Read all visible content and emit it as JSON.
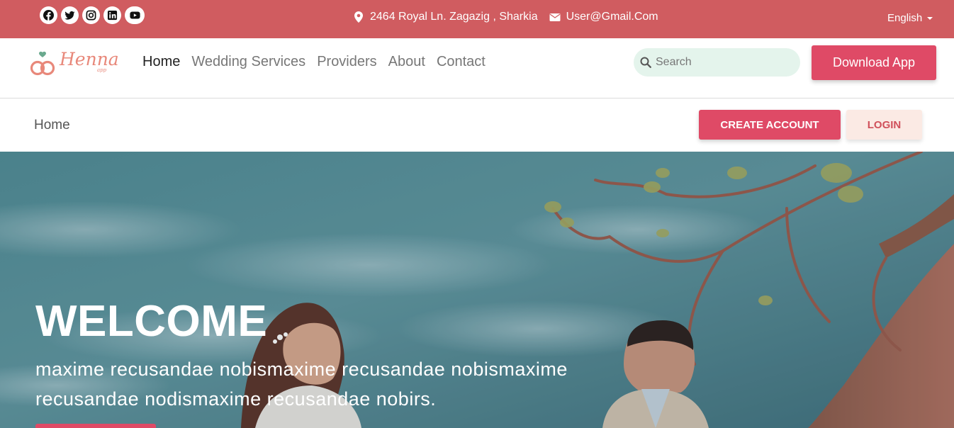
{
  "topbar": {
    "social": [
      "facebook-icon",
      "twitter-icon",
      "instagram-icon",
      "linkedin-icon",
      "youtube-icon"
    ],
    "address": "2464 Royal Ln. Zagazig , Sharkia",
    "email": "User@Gmail.Com",
    "language": "English"
  },
  "navbar": {
    "logo_text": "Henna",
    "logo_sub": "app",
    "links": [
      {
        "label": "Home",
        "active": true
      },
      {
        "label": "Wedding Services",
        "active": false
      },
      {
        "label": "Providers",
        "active": false
      },
      {
        "label": "About",
        "active": false
      },
      {
        "label": "Contact",
        "active": false
      }
    ],
    "search_placeholder": "Search",
    "download_label": "Download App"
  },
  "breadcrumb": {
    "current": "Home",
    "create_account_label": "CREATE ACCOUNT",
    "login_label": "LOGIN"
  },
  "hero": {
    "title": "WELCOME",
    "text": "maxime recusandae nobismaxime recusandae nobismaxime recusandae nodismaxime recusandae nobirs."
  },
  "colors": {
    "topbar": "#d05c60",
    "accent": "#df4a66",
    "search_bg": "#e4f4ec",
    "login_bg": "#fbeae4"
  }
}
